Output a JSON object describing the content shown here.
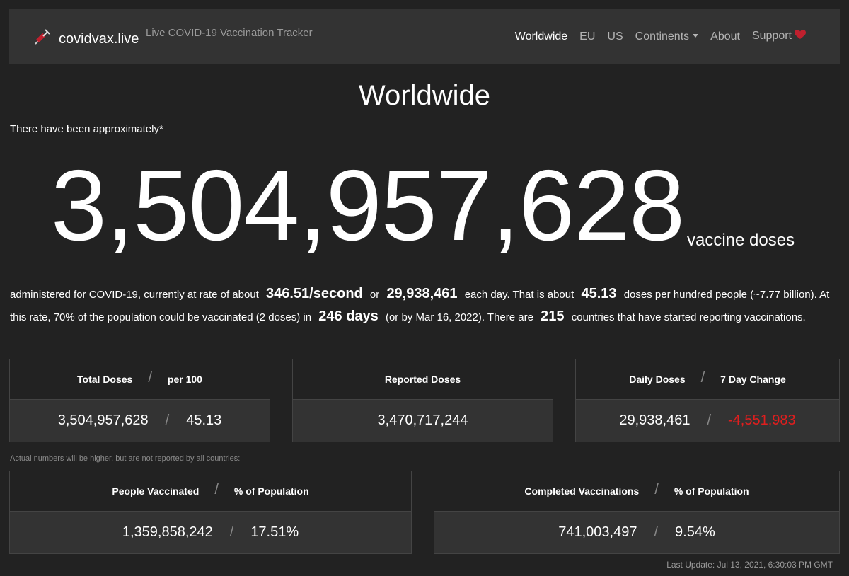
{
  "navbar": {
    "brand_name": "covidvax.live",
    "tagline": "Live COVID-19 Vaccination Tracker",
    "brand_icon": "syringe-icon",
    "items": [
      {
        "label": "Worldwide",
        "active": true
      },
      {
        "label": "EU"
      },
      {
        "label": "US"
      },
      {
        "label": "Continents",
        "dropdown": true
      },
      {
        "label": "About"
      },
      {
        "label": "Support",
        "icon": "heart-icon"
      }
    ]
  },
  "page": {
    "title": "Worldwide",
    "intro": "There have been approximately*",
    "total_doses": "3,504,957,628",
    "unit": "vaccine doses"
  },
  "summary": {
    "t1": "administered for COVID-19, currently at rate of about",
    "rate_per_second": "346.51/second",
    "t2": "or",
    "per_day": "29,938,461",
    "t3": "each day.  That is about",
    "per_hundred": "45.13",
    "t4": "doses per hundred people (~7.77 billion).  At this rate, 70% of the population could be vaccinated (2 doses) in",
    "days": "246 days",
    "t5": "(or by Mar 16, 2022).  There are",
    "countries": "215",
    "t6": "countries that have started reporting vaccinations."
  },
  "cards": {
    "total": {
      "label1": "Total Doses",
      "label2": "per 100",
      "value1": "3,504,957,628",
      "value2": "45.13"
    },
    "reported": {
      "label": "Reported Doses",
      "value": "3,470,717,244"
    },
    "daily": {
      "label1": "Daily Doses",
      "label2": "7 Day Change",
      "value1": "29,938,461",
      "value2": "-4,551,983"
    },
    "separator": "/"
  },
  "note": "Actual numbers will be higher, but are not reported by all countries:",
  "vaccinated": {
    "people": {
      "label1": "People Vaccinated",
      "label2": "% of Population",
      "value1": "1,359,858,242",
      "value2": "17.51%"
    },
    "completed": {
      "label1": "Completed Vaccinations",
      "label2": "% of Population",
      "value1": "741,003,497",
      "value2": "9.54%"
    }
  },
  "last_update": "Last Update: Jul 13, 2021, 6:30:03 PM GMT",
  "colors": {
    "background": "#222222",
    "navbar": "#333333",
    "negative": "#e01e1e",
    "heart": "#c0202e"
  }
}
